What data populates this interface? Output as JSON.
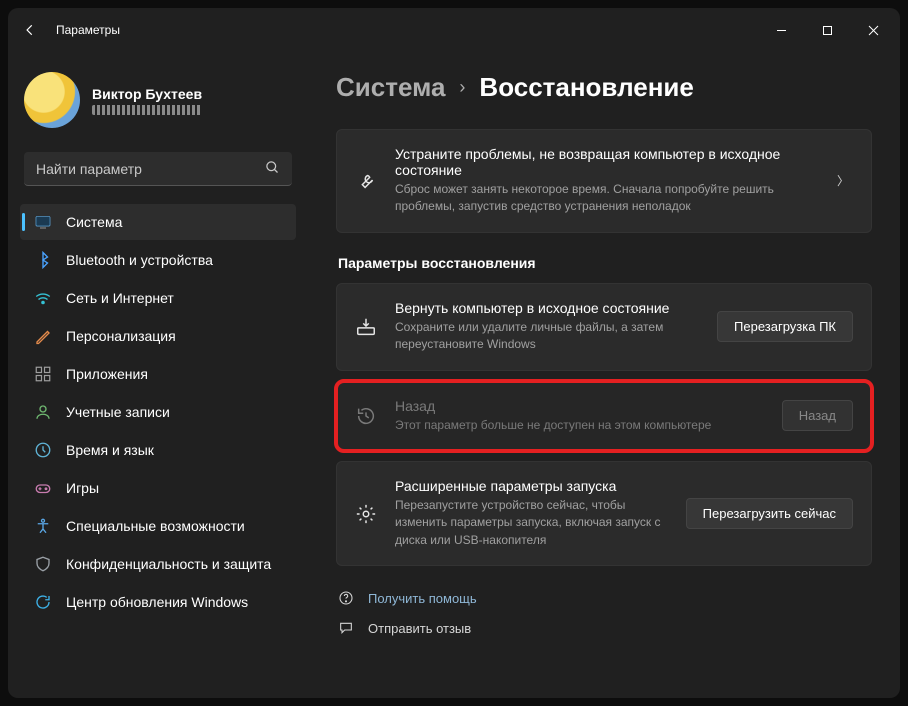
{
  "window": {
    "title": "Параметры"
  },
  "profile": {
    "name": "Виктор Бухтеев"
  },
  "search": {
    "placeholder": "Найти параметр"
  },
  "nav": [
    {
      "label": "Система",
      "id": "system",
      "active": true
    },
    {
      "label": "Bluetooth и устройства",
      "id": "bluetooth"
    },
    {
      "label": "Сеть и Интернет",
      "id": "network"
    },
    {
      "label": "Персонализация",
      "id": "personalization"
    },
    {
      "label": "Приложения",
      "id": "apps"
    },
    {
      "label": "Учетные записи",
      "id": "accounts"
    },
    {
      "label": "Время и язык",
      "id": "time"
    },
    {
      "label": "Игры",
      "id": "gaming"
    },
    {
      "label": "Специальные возможности",
      "id": "accessibility"
    },
    {
      "label": "Конфиденциальность и защита",
      "id": "privacy"
    },
    {
      "label": "Центр обновления Windows",
      "id": "update"
    }
  ],
  "breadcrumb": {
    "parent": "Система",
    "current": "Восстановление"
  },
  "troubleshoot": {
    "title": "Устраните проблемы, не возвращая компьютер в исходное состояние",
    "sub": "Сброс может занять некоторое время. Сначала попробуйте решить проблемы, запустив средство устранения неполадок"
  },
  "section_heading": "Параметры восстановления",
  "recovery": [
    {
      "title": "Вернуть компьютер в исходное состояние",
      "sub": "Сохраните или удалите личные файлы, а затем переустановите Windows",
      "button": "Перезагрузка ПК",
      "disabled": false,
      "highlight": false
    },
    {
      "title": "Назад",
      "sub": "Этот параметр больше не доступен на этом компьютере",
      "button": "Назад",
      "disabled": true,
      "highlight": true
    },
    {
      "title": "Расширенные параметры запуска",
      "sub": "Перезапустите устройство сейчас, чтобы изменить параметры запуска, включая запуск с диска или USB-накопителя",
      "button": "Перезагрузить сейчас",
      "disabled": false,
      "highlight": false
    }
  ],
  "footer": {
    "help": "Получить помощь",
    "feedback": "Отправить отзыв"
  }
}
